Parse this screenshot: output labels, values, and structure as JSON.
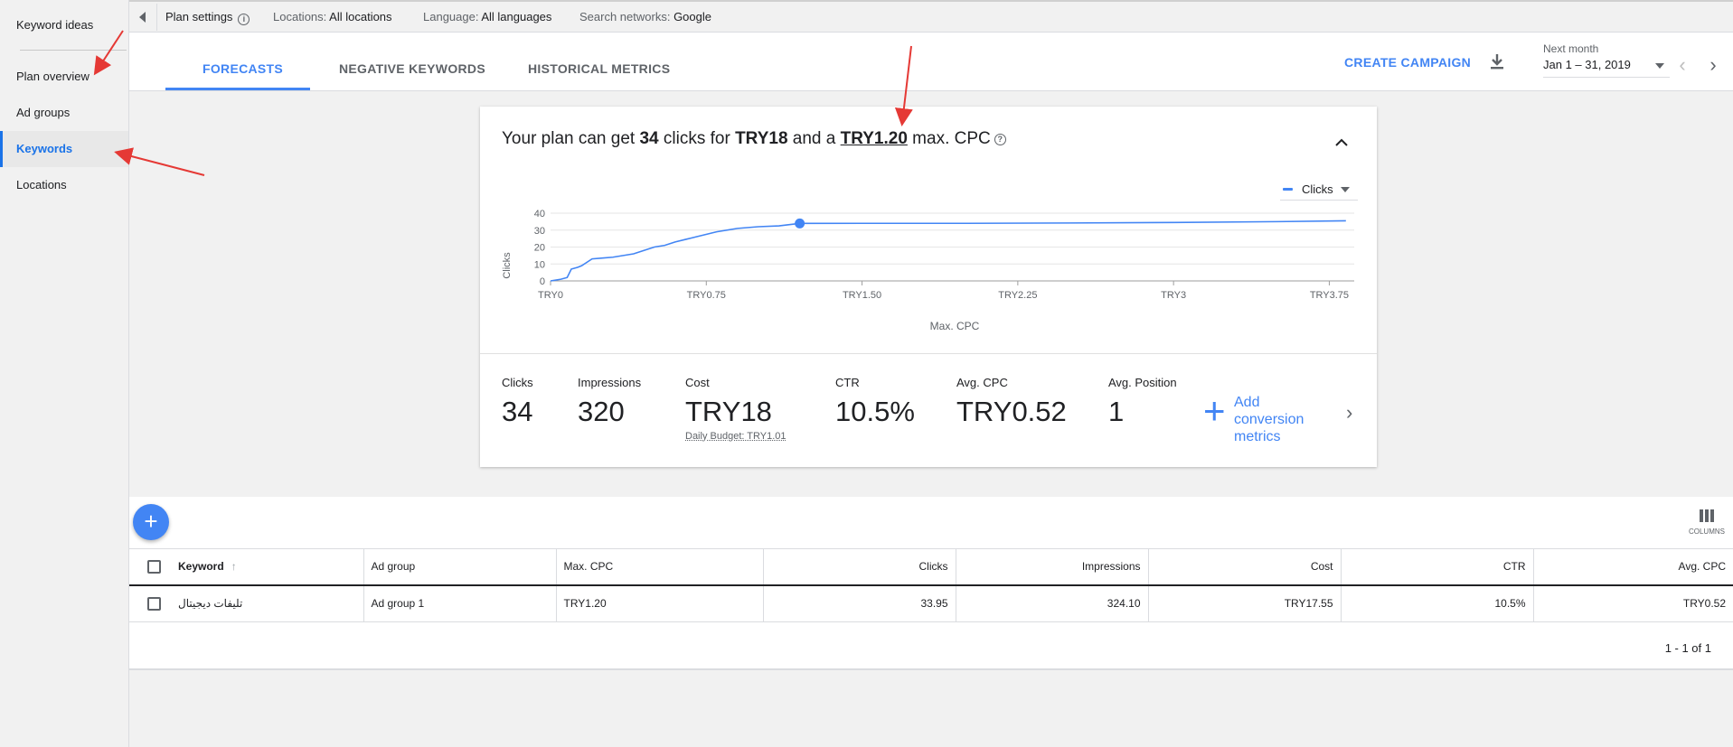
{
  "sidebar": {
    "items": [
      {
        "label": "Keyword ideas"
      },
      {
        "label": "Plan overview"
      },
      {
        "label": "Ad groups"
      },
      {
        "label": "Keywords"
      },
      {
        "label": "Locations"
      }
    ]
  },
  "topbar": {
    "plan_settings": "Plan settings",
    "locations_label": "Locations:",
    "locations_value": "All locations",
    "language_label": "Language:",
    "language_value": "All languages",
    "networks_label": "Search networks:",
    "networks_value": "Google"
  },
  "header": {
    "tabs": [
      {
        "label": "FORECASTS"
      },
      {
        "label": "NEGATIVE KEYWORDS"
      },
      {
        "label": "HISTORICAL METRICS"
      }
    ],
    "create_campaign": "CREATE CAMPAIGN",
    "next_month_label": "Next month",
    "date_range": "Jan 1 – 31, 2019"
  },
  "forecast": {
    "headline_1": "Your plan can get ",
    "clicks": "34",
    "headline_2": " clicks for ",
    "cost": "TRY18",
    "headline_3": " and a ",
    "max_cpc": "TRY1.20",
    "headline_4": " max. CPC",
    "legend_series": "Clicks",
    "metrics": {
      "clicks_label": "Clicks",
      "clicks_value": "34",
      "impressions_label": "Impressions",
      "impressions_value": "320",
      "cost_label": "Cost",
      "cost_value": "TRY18",
      "daily_budget": "Daily Budget: TRY1.01",
      "ctr_label": "CTR",
      "ctr_value": "10.5%",
      "avg_cpc_label": "Avg. CPC",
      "avg_cpc_value": "TRY0.52",
      "avg_pos_label": "Avg. Position",
      "avg_pos_value": "1",
      "add_conversion": "Add conversion metrics"
    }
  },
  "chart_data": {
    "type": "line",
    "xlabel": "Max. CPC",
    "ylabel": "Clicks",
    "x_ticks": [
      "TRY0",
      "TRY0.75",
      "TRY1.50",
      "TRY2.25",
      "TRY3",
      "TRY3.75"
    ],
    "x_tick_values": [
      0,
      0.75,
      1.5,
      2.25,
      3,
      3.75
    ],
    "y_ticks": [
      0,
      10,
      20,
      30,
      40
    ],
    "xlim": [
      0,
      3.87
    ],
    "ylim": [
      0,
      40
    ],
    "grid": true,
    "legend": "top-right",
    "series": [
      {
        "name": "Clicks",
        "color": "#4285f4",
        "x": [
          0,
          0.05,
          0.08,
          0.1,
          0.13,
          0.15,
          0.2,
          0.25,
          0.3,
          0.35,
          0.4,
          0.45,
          0.5,
          0.55,
          0.6,
          0.65,
          0.7,
          0.8,
          0.9,
          1.0,
          1.1,
          1.2,
          1.5,
          2.0,
          2.5,
          3.0,
          3.5,
          3.83
        ],
        "y": [
          0,
          1,
          2,
          7,
          8,
          9,
          13,
          13.5,
          14,
          15,
          16,
          18,
          20,
          21,
          23,
          24.5,
          26,
          29,
          31,
          32,
          32.5,
          33.95,
          34,
          34,
          34.2,
          34.5,
          35,
          35.5
        ]
      }
    ],
    "highlight_point": {
      "x": 1.2,
      "y": 33.95
    }
  },
  "table": {
    "columns_label": "COLUMNS",
    "headers": [
      "Keyword",
      "Ad group",
      "Max. CPC",
      "Clicks",
      "Impressions",
      "Cost",
      "CTR",
      "Avg. CPC"
    ],
    "rows": [
      [
        "تليفات ديجيتال",
        "Ad group 1",
        "TRY1.20",
        "33.95",
        "324.10",
        "TRY17.55",
        "10.5%",
        "TRY0.52"
      ]
    ],
    "pagination": "1 - 1 of 1"
  },
  "colors": {
    "accent": "#4285f4",
    "annotation_arrow": "#e53935"
  }
}
